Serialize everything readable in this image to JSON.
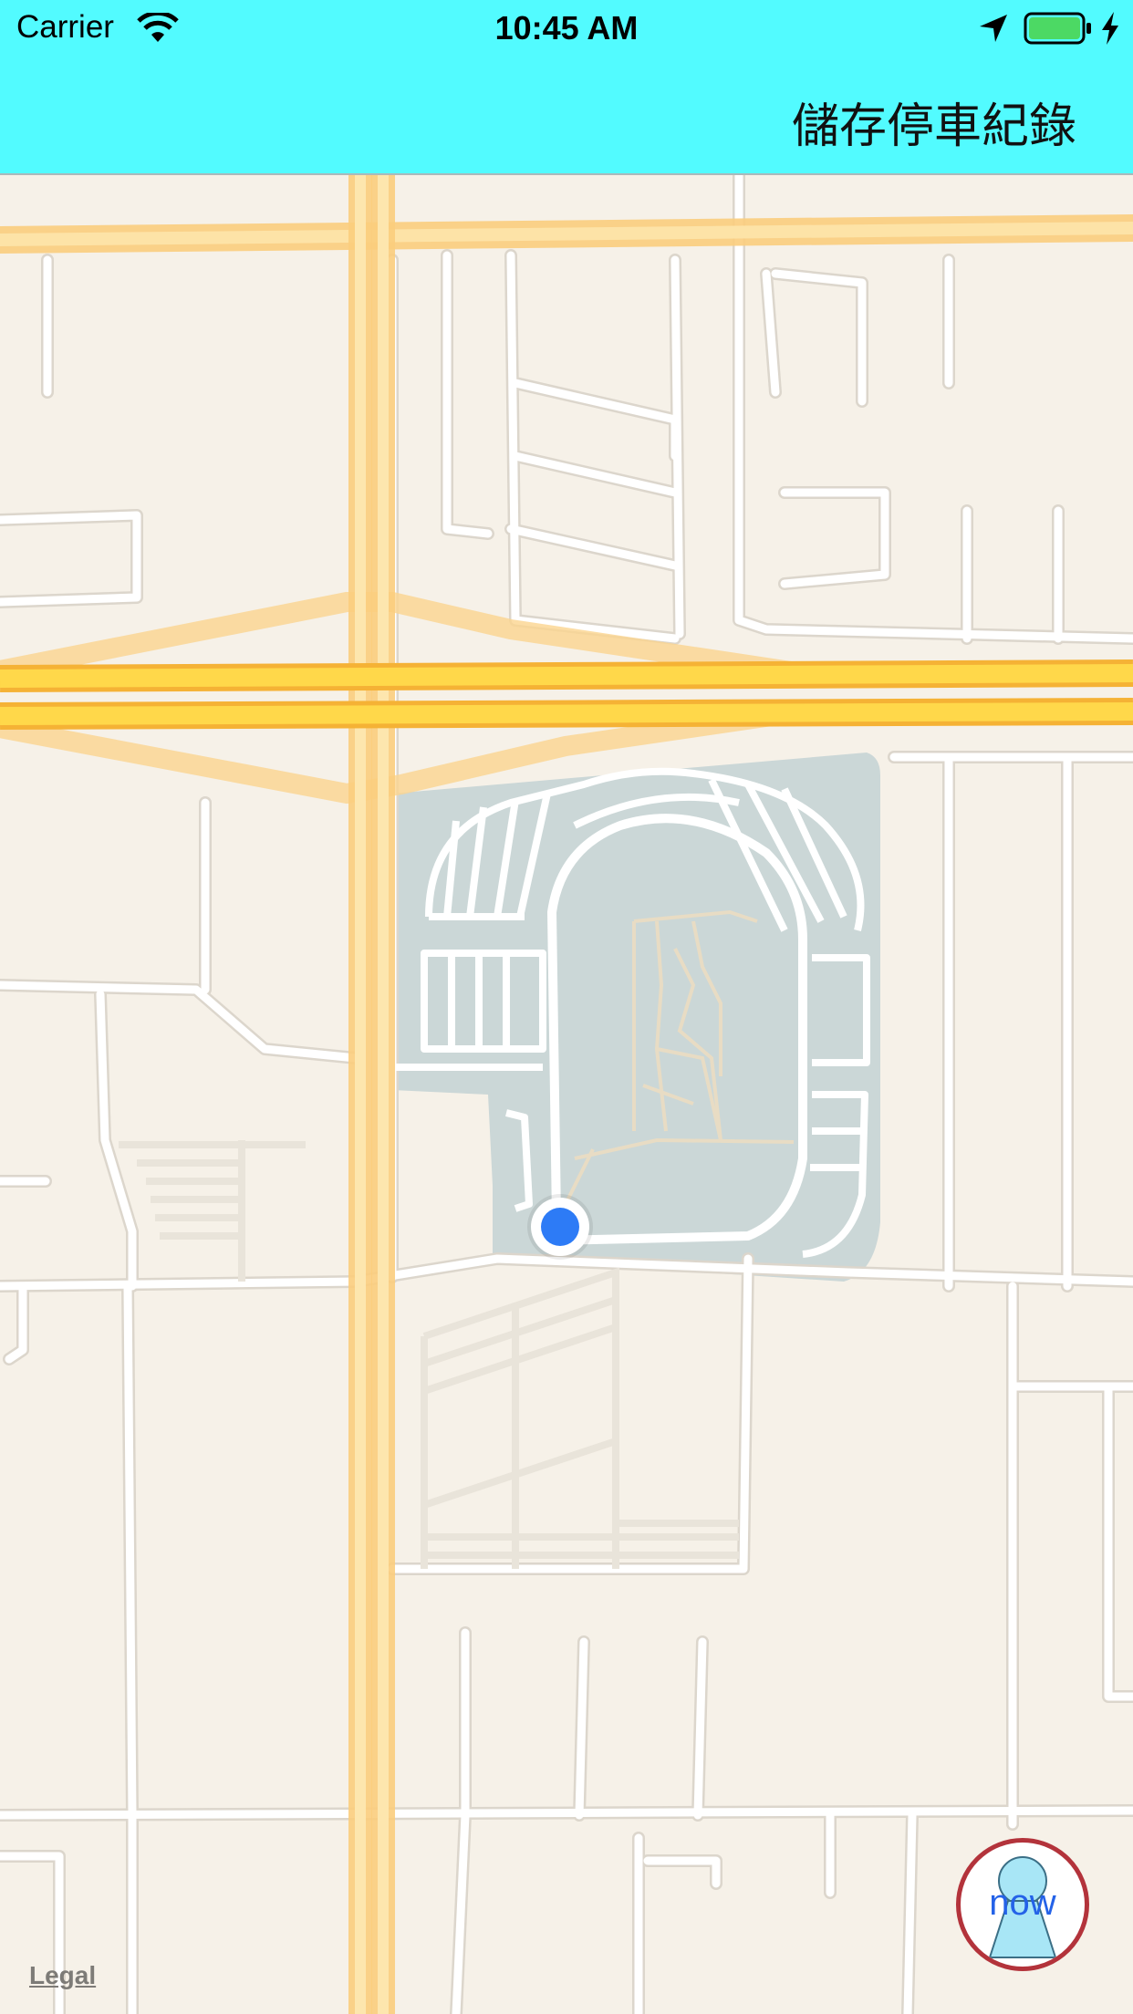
{
  "status_bar": {
    "carrier": "Carrier",
    "time": "10:45 AM",
    "battery_color": "#4cd964"
  },
  "nav_bar": {
    "background": "#52fbff",
    "save_record_label": "儲存停車紀錄"
  },
  "map": {
    "legal_label": "Legal",
    "user_location_color": "#2d7bf6"
  },
  "now_button": {
    "label": "now",
    "icon": "person-icon",
    "border_color": "#b3333b"
  }
}
